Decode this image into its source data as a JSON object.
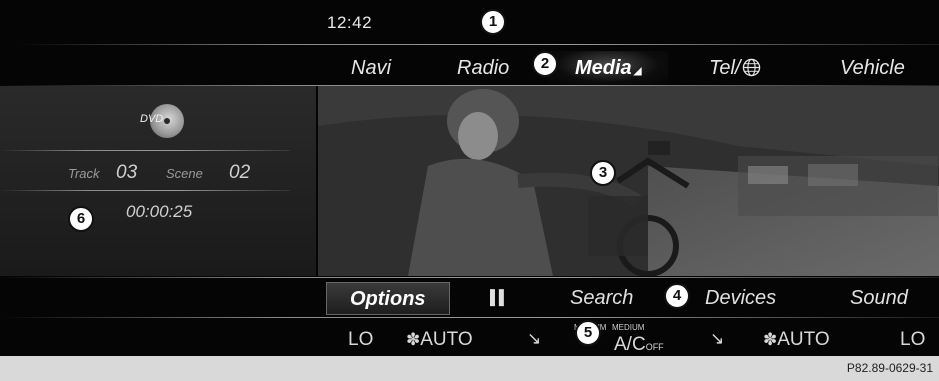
{
  "status": {
    "clock": "12:42"
  },
  "topnav": {
    "items": [
      "Navi",
      "Radio",
      "Media",
      "Tel/",
      "Vehicle"
    ],
    "active": "Media"
  },
  "left_panel": {
    "source": "DVD",
    "track_label": "Track",
    "track_value": "03",
    "scene_label": "Scene",
    "scene_value": "02",
    "elapsed": "00:00:25"
  },
  "bottom_bar": {
    "options": "Options",
    "search": "Search",
    "devices": "Devices",
    "sound": "Sound"
  },
  "climate": {
    "left_temp": "LO",
    "left_fan": "AUTO",
    "left_air_label": "MEDIUM",
    "right_air_label": "MEDIUM",
    "ac_main": "A/C",
    "ac_sub": "OFF",
    "right_fan": "AUTO",
    "right_temp": "LO"
  },
  "callouts": [
    "1",
    "2",
    "3",
    "4",
    "5",
    "6"
  ],
  "footer": {
    "ref": "P82.89-0629-31"
  },
  "icons": [
    "globe-icon",
    "pause-icon",
    "fan-icon",
    "air-distribution-icon",
    "dvd-disc-icon"
  ],
  "colors": {
    "screen_bg": "#050505",
    "text": "#e6e6e6",
    "footer_bg": "#d9d9d9"
  }
}
